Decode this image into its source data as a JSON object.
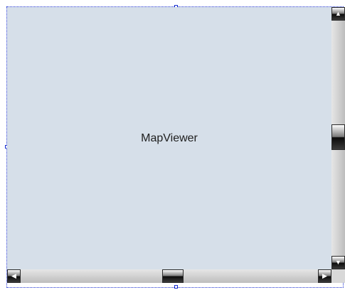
{
  "control": {
    "name": "MapViewer"
  },
  "vertical_scrollbar": {
    "up_icon": "arrow-up-icon",
    "down_icon": "arrow-down-icon",
    "position": 0.5
  },
  "horizontal_scrollbar": {
    "left_icon": "arrow-left-icon",
    "right_icon": "arrow-right-icon",
    "position": 0.5
  },
  "colors": {
    "map_background": "#d6dfe9",
    "selection_border": "#1a2fd0"
  }
}
